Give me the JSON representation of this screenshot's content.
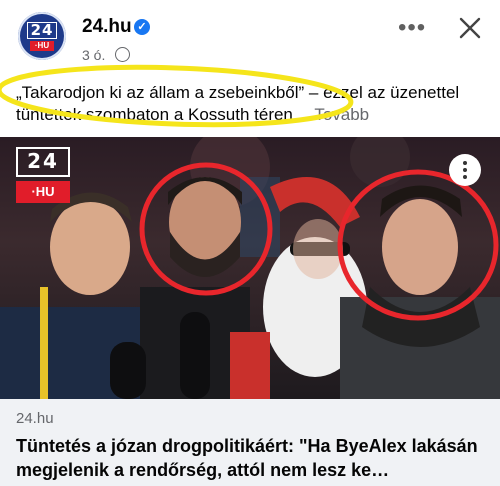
{
  "post": {
    "page_name": "24.hu",
    "time": "3 ó.",
    "caption": "„Takarodjon ki az állam a zsebeinkből” – ezzel az üzenettel tüntettek szombaton a Kossuth téren…",
    "see_more": "Tovább"
  },
  "avatar": {
    "top": "24",
    "bottom": "·HU"
  },
  "photo_logo": {
    "top": "24",
    "bottom": "·HU"
  },
  "link_card": {
    "source": "24.hu",
    "title": "Tüntetés a józan drogpolitikáért: \"Ha ByeAlex lakásán megjelenik a rendőrség, attól nem lesz ke…"
  },
  "icons": {
    "verified": "verified-badge-icon",
    "audience": "globe-icon",
    "more": "more-options-icon",
    "close": "close-icon"
  },
  "colors": {
    "annotation_yellow": "#f5e51b",
    "annotation_red": "#e8262c",
    "brand_blue": "#1877f2",
    "logo_red": "#e11d2a"
  }
}
